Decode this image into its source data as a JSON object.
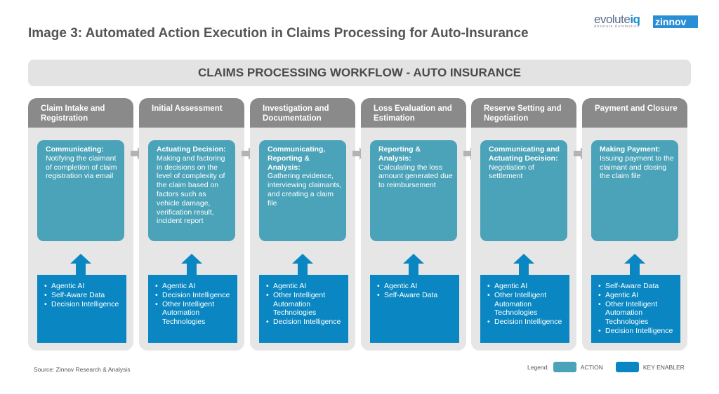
{
  "title": "Image 3: Automated Action Execution in Claims Processing for Auto-Insurance",
  "logos": {
    "evolute": "evolute",
    "iq": "iq",
    "evolute_tag": "Absolute Automation",
    "zinnov": "zinnov"
  },
  "banner": "CLAIMS PROCESSING WORKFLOW - AUTO INSURANCE",
  "colors": {
    "header": "#8a8a8a",
    "column_bg": "#e6e6e6",
    "action": "#4aa3b9",
    "key_enabler": "#0a87c2"
  },
  "stages": [
    {
      "title": "Claim Intake and Registration",
      "action_label": "Communicating:",
      "action_text": "Notifying the claimant of completion of claim registration via email",
      "enablers": [
        "Agentic AI",
        "Self-Aware Data",
        "Decision Intelligence"
      ]
    },
    {
      "title": "Initial Assessment",
      "action_label": "Actuating Decision:",
      "action_text": "Making and factoring in decisions on the level of complexity of the claim based on factors such as vehicle damage, verification result, incident report",
      "enablers": [
        "Agentic AI",
        "Decision Intelligence",
        "Other Intelligent Automation Technologies"
      ]
    },
    {
      "title": "Investigation and Documentation",
      "action_label": "Communicating, Reporting & Analysis:",
      "action_text": "Gathering evidence, interviewing claimants, and creating a claim file",
      "enablers": [
        "Agentic AI",
        "Other Intelligent Automation Technologies",
        "Decision Intelligence"
      ]
    },
    {
      "title": "Loss Evaluation and Estimation",
      "action_label": "Reporting & Analysis:",
      "action_text": "Calculating the loss amount generated due to reimbursement",
      "enablers": [
        "Agentic AI",
        "Self-Aware Data"
      ]
    },
    {
      "title": "Reserve Setting and Negotiation",
      "action_label": "Communicating and Actuating Decision:",
      "action_text": "Negotiation of settlement",
      "enablers": [
        "Agentic AI",
        "Other Intelligent Automation Technologies",
        "Decision Intelligence"
      ]
    },
    {
      "title": "Payment and Closure",
      "action_label": "Making Payment:",
      "action_text": "Issuing payment to the claimant and closing the claim file",
      "enablers": [
        "Self-Aware Data",
        "Agentic AI",
        "Other Intelligent Automation Technologies",
        "Decision Intelligence"
      ]
    }
  ],
  "source": "Source: Zinnov Research & Analysis",
  "legend": {
    "label": "Legend:",
    "action": "ACTION",
    "key_enabler": "KEY ENABLER"
  }
}
